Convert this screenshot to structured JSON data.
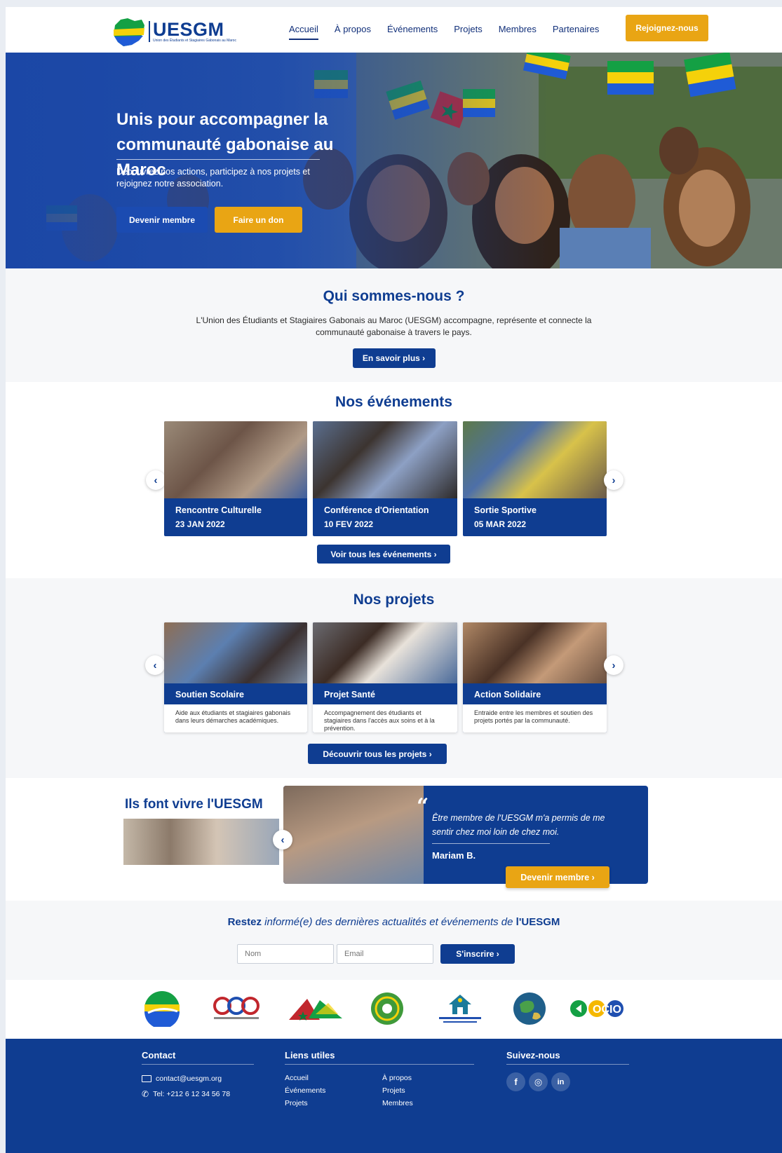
{
  "brand": {
    "name": "UESGM",
    "tagline": "Union des Étudiants et Stagiaires Gabonais au Maroc",
    "colors": {
      "primary": "#0f3d91",
      "accent": "#e9a514",
      "gabon_green": "#14a044",
      "gabon_yellow": "#f5d10a",
      "gabon_blue": "#1f5bd6"
    }
  },
  "nav": {
    "items": [
      "Accueil",
      "À propos",
      "Événements",
      "Projets",
      "Membres",
      "Partenaires"
    ],
    "active": "Accueil",
    "cta": "Rejoignez-nous"
  },
  "hero": {
    "title_line1": "Unis pour accompagner la",
    "title_line2": "communauté gabonaise au Maroc",
    "subtitle": "Découvrez nos actions, participez à nos projets et rejoignez notre association.",
    "btn_member": "Devenir membre",
    "btn_donate": "Faire un don"
  },
  "about": {
    "title": "Qui sommes-nous ?",
    "text": "L'Union des Étudiants et Stagiaires Gabonais au Maroc (UESGM) accompagne, représente et connecte la communauté gabonaise à travers le pays.",
    "button": "En savoir plus ›"
  },
  "events": {
    "title": "Nos événements",
    "items": [
      {
        "title": "Rencontre Culturelle",
        "date": "23 JAN 2022"
      },
      {
        "title": "Conférence d'Orientation",
        "date": "10 FEV 2022"
      },
      {
        "title": "Sortie Sportive",
        "date": "05 MAR 2022"
      }
    ],
    "button": "Voir tous les événements ›",
    "prev_icon": "‹",
    "next_icon": "›"
  },
  "projects": {
    "title": "Nos projets",
    "items": [
      {
        "title": "Soutien Scolaire",
        "desc": "Aide aux étudiants et stagiaires gabonais dans leurs démarches académiques."
      },
      {
        "title": "Projet Santé",
        "desc": "Accompagnement des étudiants et stagiaires dans l'accès aux soins et à la prévention."
      },
      {
        "title": "Action Solidaire",
        "desc": "Entraide entre les membres et soutien des projets portés par la communauté."
      }
    ],
    "button": "Découvrir tous les projets ›"
  },
  "testimonials": {
    "title": "Ils font vivre l'UESGM",
    "quote": "Être membre de l'UESGM m'a permis de me sentir chez moi loin de chez moi.",
    "author": "Mariam B.",
    "button": "Devenir membre ›",
    "prev_icon": "‹"
  },
  "newsletter": {
    "title_part1": "Restez ",
    "title_part2": "informé(e) des dernières actualités et événements de",
    "title_part3": " l'UESGM",
    "name_placeholder": "Nom",
    "email_placeholder": "Email",
    "button": "S'inscrire ›"
  },
  "partners": {
    "logos": [
      "gabon-globe-logo",
      "chain-rings-logo",
      "maroc-gabon-flags-logo",
      "green-seal-logo",
      "house-institution-logo",
      "earth-globe-logo",
      "ocio-logo"
    ],
    "ocio_text": "OCIO"
  },
  "footer": {
    "contact_title": "Contact",
    "email": "contact@uesgm.org",
    "phone": "Tel: +212 6 12 34 56 78",
    "links_title": "Liens utiles",
    "links_col1": [
      "Accueil",
      "Événements",
      "Projets"
    ],
    "links_col2": [
      "À propos",
      "Projets",
      "Membres"
    ],
    "social_title": "Suivez-nous",
    "social": [
      "f",
      "◎",
      "in"
    ]
  }
}
